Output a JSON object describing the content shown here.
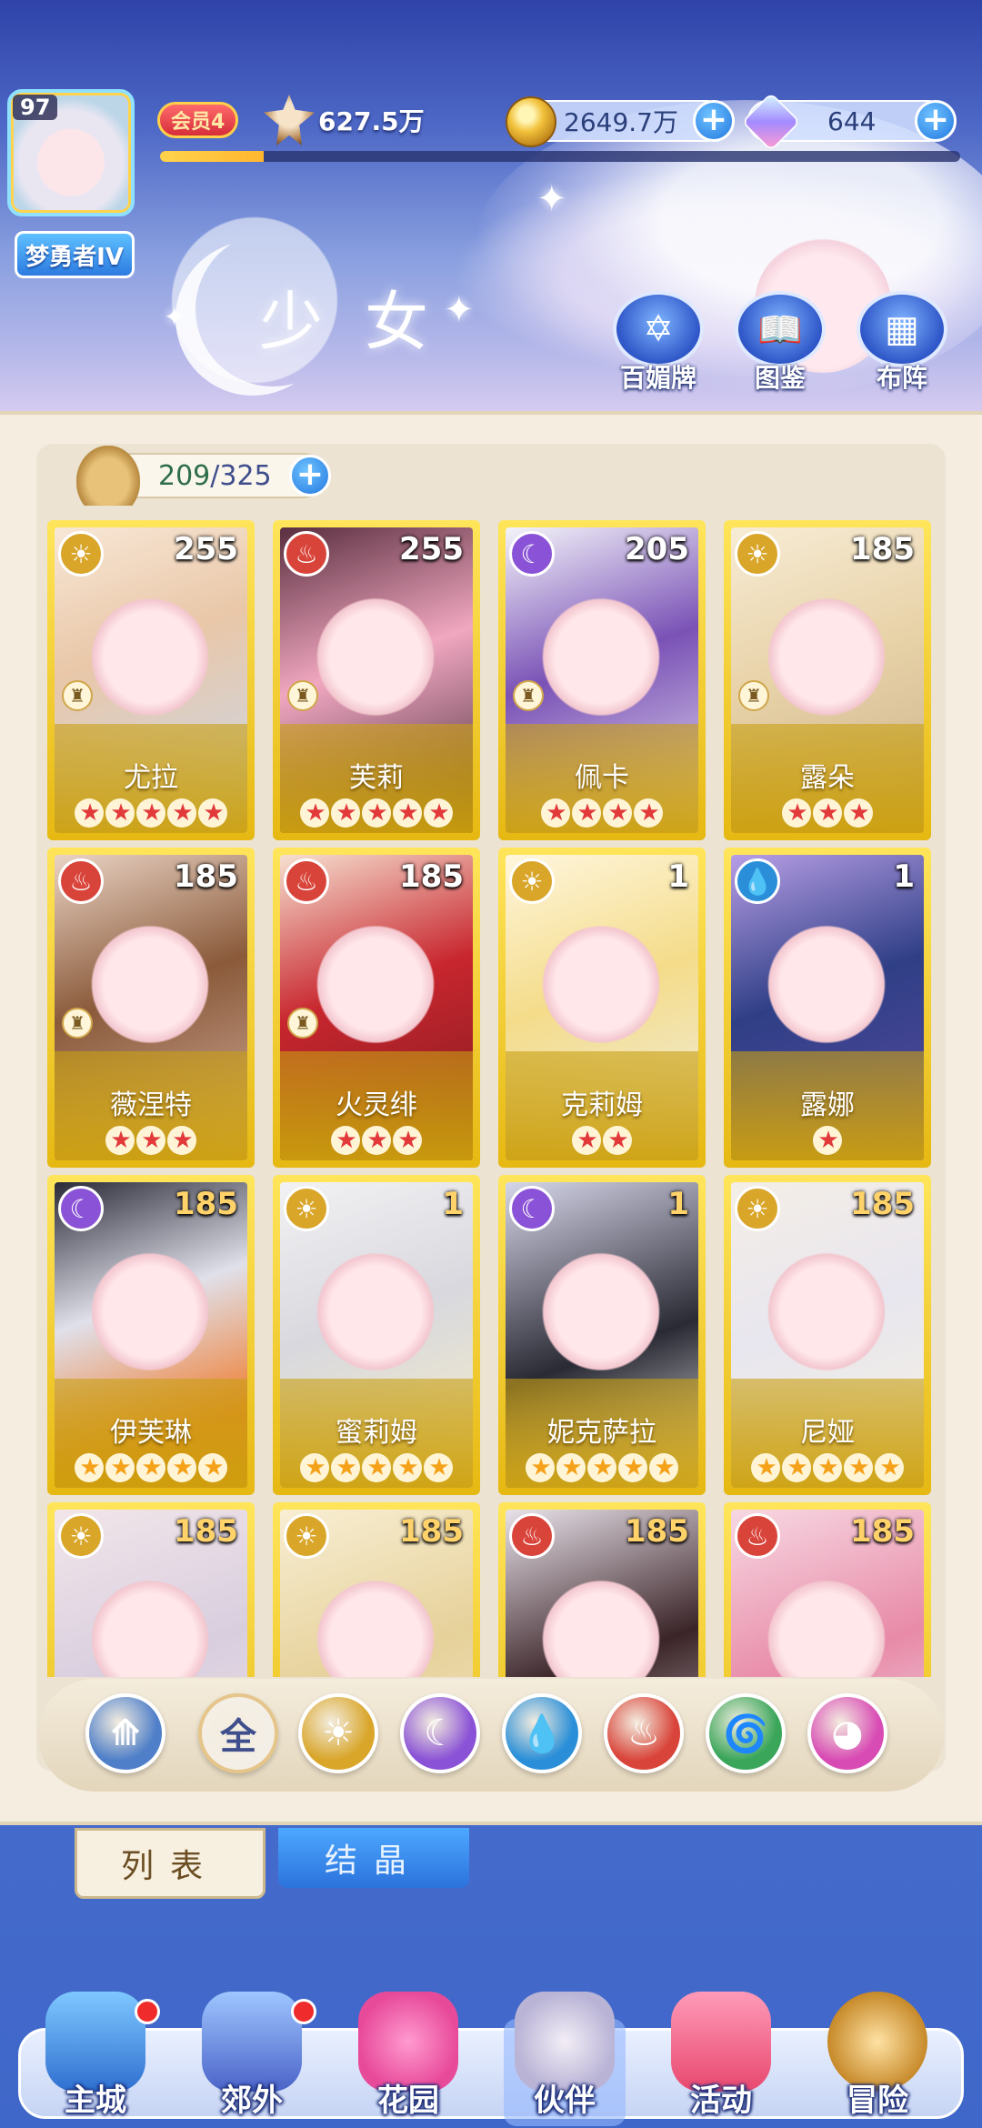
{
  "header": {
    "avatar_level": "97",
    "player_title": "梦勇者IV",
    "vip_label": "会员4",
    "power": "627.5万",
    "xp_progress": 0.13,
    "coins": "2649.7万",
    "gems": "644",
    "page_title": "少女",
    "buttons": [
      {
        "label": "百媚牌",
        "icon": "badge-icon"
      },
      {
        "label": "图鉴",
        "icon": "book-icon"
      },
      {
        "label": "布阵",
        "icon": "grid-icon"
      }
    ]
  },
  "roster": {
    "owned": "209",
    "separator": "/",
    "capacity": "325"
  },
  "cards": [
    {
      "name": "尤拉",
      "level": "255",
      "element": "light",
      "stars": 5,
      "star_color": "red",
      "role": true
    },
    {
      "name": "芙莉",
      "level": "255",
      "element": "fire",
      "stars": 5,
      "star_color": "red",
      "role": true
    },
    {
      "name": "佩卡",
      "level": "205",
      "element": "moon",
      "stars": 4,
      "star_color": "red",
      "role": true
    },
    {
      "name": "露朵",
      "level": "185",
      "element": "light",
      "stars": 3,
      "star_color": "red",
      "role": true
    },
    {
      "name": "薇涅特",
      "level": "185",
      "element": "fire",
      "stars": 3,
      "star_color": "red",
      "role": true
    },
    {
      "name": "火灵绯",
      "level": "185",
      "element": "fire",
      "stars": 3,
      "star_color": "red",
      "role": true
    },
    {
      "name": "克莉姆",
      "level": "1",
      "element": "light",
      "stars": 2,
      "star_color": "red",
      "role": false
    },
    {
      "name": "露娜",
      "level": "1",
      "element": "water",
      "stars": 1,
      "star_color": "red",
      "role": false
    },
    {
      "name": "伊芙琳",
      "level": "185",
      "element": "moon",
      "stars": 5,
      "star_color": "gold",
      "role": false
    },
    {
      "name": "蜜莉姆",
      "level": "1",
      "element": "light",
      "stars": 5,
      "star_color": "gold",
      "role": false
    },
    {
      "name": "妮克萨拉",
      "level": "1",
      "element": "moon",
      "stars": 5,
      "star_color": "gold",
      "role": false
    },
    {
      "name": "尼娅",
      "level": "185",
      "element": "light",
      "stars": 5,
      "star_color": "gold",
      "role": false
    },
    {
      "name": "",
      "level": "185",
      "element": "light",
      "stars": 0,
      "star_color": "gold",
      "role": false
    },
    {
      "name": "",
      "level": "185",
      "element": "light",
      "stars": 0,
      "star_color": "gold",
      "role": false
    },
    {
      "name": "",
      "level": "185",
      "element": "fire",
      "stars": 0,
      "star_color": "gold",
      "role": false
    },
    {
      "name": "",
      "level": "185",
      "element": "fire",
      "stars": 0,
      "star_color": "gold",
      "role": false
    }
  ],
  "filters": [
    {
      "key": "wind",
      "label": "",
      "color": "#4f7fc9"
    },
    {
      "key": "all",
      "label": "全",
      "color": "#f4efe6"
    },
    {
      "key": "light",
      "label": "",
      "color": "#d9a62a"
    },
    {
      "key": "moon",
      "label": "",
      "color": "#8a52d6"
    },
    {
      "key": "water",
      "label": "",
      "color": "#2a8fd8"
    },
    {
      "key": "fire",
      "label": "",
      "color": "#d9443a"
    },
    {
      "key": "nature",
      "label": "",
      "color": "#3aa65a"
    },
    {
      "key": "charm",
      "label": "",
      "color": "#d84bb4"
    }
  ],
  "tabs": {
    "list": "列表",
    "crystal": "结晶"
  },
  "nav": [
    {
      "label": "主城",
      "icon": "castle-icon",
      "badge": true
    },
    {
      "label": "郊外",
      "icon": "portal-icon",
      "badge": true
    },
    {
      "label": "花园",
      "icon": "heart-icon",
      "badge": false
    },
    {
      "label": "伙伴",
      "icon": "partner-icon",
      "badge": false
    },
    {
      "label": "活动",
      "icon": "gift-icon",
      "badge": false
    },
    {
      "label": "冒险",
      "icon": "compass-icon",
      "badge": false
    }
  ],
  "colors": {
    "element_light": "#d9a62a",
    "element_fire": "#d9443a",
    "element_moon": "#8a52d6",
    "element_water": "#2a8fd8"
  }
}
